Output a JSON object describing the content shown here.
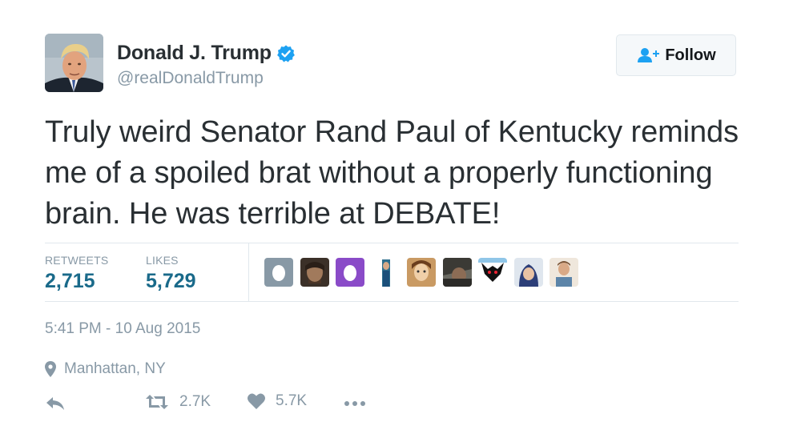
{
  "user": {
    "name": "Donald J. Trump",
    "handle": "@realDonaldTrump",
    "verified": true
  },
  "follow": {
    "label": "Follow"
  },
  "tweet": {
    "text": "Truly weird Senator Rand Paul of Kentucky reminds me of a spoiled brat without a properly functioning brain. He was terrible at DEBATE!"
  },
  "stats": {
    "retweets_label": "RETWEETS",
    "retweets_value": "2,715",
    "likes_label": "LIKES",
    "likes_value": "5,729"
  },
  "likers": [
    {
      "name": "liker-avatar-egg-gray"
    },
    {
      "name": "liker-avatar-photo"
    },
    {
      "name": "liker-avatar-egg-purple"
    },
    {
      "name": "liker-avatar-photo"
    },
    {
      "name": "liker-avatar-photo"
    },
    {
      "name": "liker-avatar-photo"
    },
    {
      "name": "liker-avatar-photo"
    },
    {
      "name": "liker-avatar-photo"
    },
    {
      "name": "liker-avatar-photo"
    }
  ],
  "meta": {
    "timestamp": "5:41 PM - 10 Aug 2015",
    "location": "Manhattan, NY"
  },
  "actions": {
    "retweet_count": "2.7K",
    "like_count": "5.7K"
  },
  "colors": {
    "accent": "#1da1f2",
    "stat_value": "#1a6a8a",
    "muted": "#8899a6",
    "text": "#292f33"
  }
}
